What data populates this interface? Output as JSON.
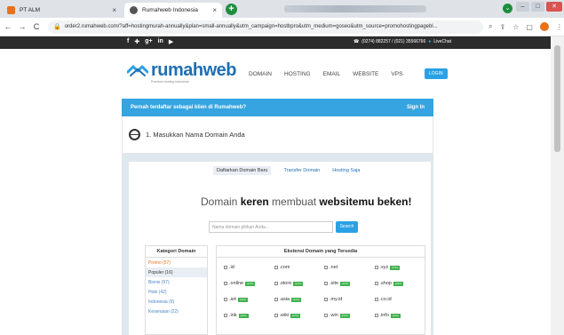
{
  "browser": {
    "tabs": [
      {
        "title": "PT ALM",
        "favicon_color": "#e8711a"
      },
      {
        "title": "Rumahweb Indonesia",
        "favicon_color": "#555555"
      }
    ],
    "new_tab": "+",
    "url": "order2.rumahweb.com/?aff=hostingmurah-annually&plan=small-annually&utm_campaign=hostbpro&utm_medium=goseo&utm_source=promohostingpagebl..."
  },
  "topbar": {
    "social": [
      "f",
      "✚",
      "g+",
      "in",
      "▶"
    ],
    "phone": "(0274) 882257 / (021) 35566766",
    "live_chat": "LiveChat"
  },
  "header": {
    "logo": "rumahweb",
    "tagline": "Premium hosting Indonesia",
    "nav": [
      "DOMAIN",
      "HOSTING",
      "EMAIL",
      "WEBSITE",
      "VPS"
    ],
    "login": "LOGIN"
  },
  "banner": {
    "text": "Pernah terdaftar sebagai klien di Rumahweb?",
    "signin": "Sign In"
  },
  "step": {
    "label": "1. Masukkan Nama Domain Anda"
  },
  "domain_tabs": [
    "Daftarkan Domain Baru",
    "Transfer Domain",
    "Hosting Saja"
  ],
  "headline": {
    "pre": "Domain ",
    "strong1": "keren",
    "mid": " membuat ",
    "strong2": "websitemu beken!"
  },
  "search": {
    "placeholder": "Nama domain pilihan Anda...",
    "button": "Search"
  },
  "categories": {
    "title": "Kategori Domain",
    "items": [
      "Promo (57)",
      "Populer (16)",
      "Bisnis (97)",
      "Hobi (42)",
      "Indonesia (9)",
      "Kesenaian (22)"
    ]
  },
  "extensions": {
    "title": "Ekstensi Domain yang Tersedia",
    "items": [
      {
        "name": ".id",
        "promo": false
      },
      {
        "name": ".com",
        "promo": false
      },
      {
        "name": ".net",
        "promo": false
      },
      {
        "name": ".xyz",
        "promo": true
      },
      {
        "name": ".online",
        "promo": true
      },
      {
        "name": ".store",
        "promo": true
      },
      {
        "name": ".site",
        "promo": true
      },
      {
        "name": ".shop",
        "promo": true
      },
      {
        "name": ".art",
        "promo": true
      },
      {
        "name": ".asia",
        "promo": true
      },
      {
        "name": ".my.id",
        "promo": false
      },
      {
        "name": ".co.id",
        "promo": false
      },
      {
        "name": ".ink",
        "promo": true
      },
      {
        "name": ".wiki",
        "promo": true
      },
      {
        "name": ".win",
        "promo": true
      },
      {
        "name": ".info",
        "promo": true
      }
    ],
    "promo_label": "promo"
  }
}
